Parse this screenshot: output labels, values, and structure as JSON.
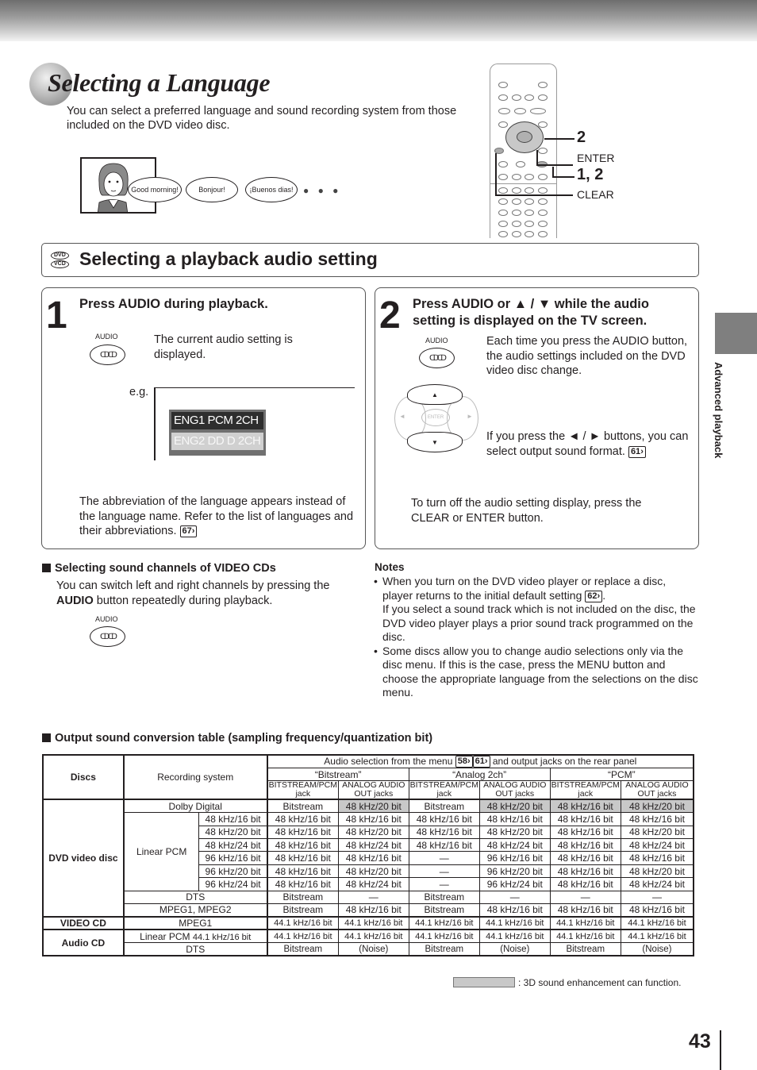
{
  "page": {
    "title": "Selecting a Language",
    "intro": "You can select a preferred language and sound recording system from those included on the DVD video disc.",
    "page_number": "43",
    "side_tab_label": "Advanced playback"
  },
  "illustration": {
    "bubbles": [
      "Good morning!",
      "Bonjour!",
      "¡Buenos dias!"
    ],
    "ellipsis": "● ● ●"
  },
  "remote": {
    "callouts": {
      "step2": "2",
      "enter": "ENTER",
      "step12": "1, 2",
      "clear": "CLEAR"
    }
  },
  "section": {
    "badges": [
      "DVD",
      "VCD"
    ],
    "title": "Selecting a playback audio setting"
  },
  "step1": {
    "number": "1",
    "heading": "Press AUDIO during playback.",
    "button_label": "AUDIO",
    "button_glyph": "ↀↀ",
    "description": "The current audio setting is displayed.",
    "eg_label": "e.g.",
    "osd_line1": "ENG1 PCM 2CH",
    "osd_line2": "ENG2 DD D 2CH",
    "footnote": "The abbreviation of the language appears instead of the language name. Refer to the list of languages and their abbreviations.",
    "footnote_ref": "67"
  },
  "step2": {
    "number": "2",
    "heading_line1": "Press AUDIO or ▲ / ▼ while the audio",
    "heading_line2": "setting is displayed on the TV screen.",
    "button_label": "AUDIO",
    "description": "Each time you press the AUDIO button, the audio settings included on the DVD video disc change.",
    "dpad": {
      "up": "▲",
      "down": "▼",
      "left": "◄",
      "right": "►",
      "center": "ENTER"
    },
    "lr_text": "If you press the ◄ / ► buttons, you can select output sound format.",
    "lr_ref": "61",
    "off_text": "To turn off the audio setting display, press the CLEAR or ENTER button."
  },
  "vcd": {
    "heading": "Selecting sound channels of VIDEO CDs",
    "text_pre": "You can switch left and right channels by pressing the ",
    "text_bold": "AUDIO",
    "text_post": " button repeatedly during playback.",
    "button_label": "AUDIO"
  },
  "notes": {
    "heading": "Notes",
    "item1_a": "When you turn on the DVD video player or replace a disc, player returns to the initial default setting ",
    "item1_ref": "62",
    "item1_b": ".",
    "item1_c": "If you select a sound track which is not included on the disc, the DVD video player plays a prior sound track programmed on the disc.",
    "item2": "Some discs allow you to change audio selections only via the disc menu.  If this is the case, press the MENU button and choose the appropriate language from the selections on the disc menu."
  },
  "table": {
    "heading": "Output sound conversion table (sampling frequency/quantization bit)",
    "col_discs": "Discs",
    "col_recording": "Recording system",
    "audio_sel_pre": "Audio selection from the menu ",
    "audio_sel_refs": [
      "58",
      "61"
    ],
    "audio_sel_post": " and output jacks on the rear panel",
    "modes": [
      "“Bitstream”",
      "“Analog 2ch”",
      "“PCM”"
    ],
    "jack_bitstream": "BITSTREAM/PCM jack",
    "jack_analog": "ANALOG AUDIO OUT jacks",
    "rows": [
      {
        "disc": "DVD video disc",
        "system": "Dolby Digital",
        "sub": "",
        "cells": [
          "Bitstream",
          "48 kHz/20 bit",
          "Bitstream",
          "48 kHz/20 bit",
          "48 kHz/16 bit",
          "48 kHz/20 bit"
        ],
        "hl": [
          false,
          true,
          false,
          true,
          true,
          true
        ]
      },
      {
        "disc": "",
        "system": "Linear PCM",
        "sub": "48 kHz/16 bit",
        "cells": [
          "48 kHz/16 bit",
          "48 kHz/16 bit",
          "48 kHz/16 bit",
          "48 kHz/16 bit",
          "48 kHz/16 bit",
          "48 kHz/16 bit"
        ]
      },
      {
        "disc": "",
        "system": "",
        "sub": "48 kHz/20 bit",
        "cells": [
          "48 kHz/16 bit",
          "48 kHz/20 bit",
          "48 kHz/16 bit",
          "48 kHz/20 bit",
          "48 kHz/16 bit",
          "48 kHz/20 bit"
        ]
      },
      {
        "disc": "",
        "system": "",
        "sub": "48 kHz/24 bit",
        "cells": [
          "48 kHz/16 bit",
          "48 kHz/24 bit",
          "48 kHz/16 bit",
          "48 kHz/24 bit",
          "48 kHz/16 bit",
          "48 kHz/24 bit"
        ]
      },
      {
        "disc": "",
        "system": "",
        "sub": "96 kHz/16 bit",
        "cells": [
          "48 kHz/16 bit",
          "48 kHz/16 bit",
          "—",
          "96 kHz/16 bit",
          "48 kHz/16 bit",
          "48 kHz/16 bit"
        ]
      },
      {
        "disc": "",
        "system": "",
        "sub": "96 kHz/20 bit",
        "cells": [
          "48 kHz/16 bit",
          "48 kHz/20 bit",
          "—",
          "96 kHz/20 bit",
          "48 kHz/16 bit",
          "48 kHz/20 bit"
        ]
      },
      {
        "disc": "",
        "system": "",
        "sub": "96 kHz/24 bit",
        "cells": [
          "48 kHz/16 bit",
          "48 kHz/24 bit",
          "—",
          "96 kHz/24 bit",
          "48 kHz/16 bit",
          "48 kHz/24 bit"
        ]
      },
      {
        "disc": "",
        "system": "DTS",
        "sub": "",
        "cells": [
          "Bitstream",
          "—",
          "Bitstream",
          "—",
          "—",
          "—"
        ]
      },
      {
        "disc": "",
        "system": "MPEG1, MPEG2",
        "sub": "",
        "cells": [
          "Bitstream",
          "48 kHz/16 bit",
          "Bitstream",
          "48 kHz/16 bit",
          "48 kHz/16 bit",
          "48 kHz/16 bit"
        ]
      },
      {
        "disc": "VIDEO CD",
        "system": "MPEG1",
        "sub": "",
        "cells": [
          "44.1 kHz/16 bit",
          "44.1 kHz/16 bit",
          "44.1 kHz/16 bit",
          "44.1 kHz/16 bit",
          "44.1 kHz/16 bit",
          "44.1 kHz/16 bit"
        ]
      },
      {
        "disc": "Audio CD",
        "system": "Linear PCM",
        "sub": "44.1 kHz/16 bit",
        "cells": [
          "44.1 kHz/16 bit",
          "44.1 kHz/16 bit",
          "44.1 kHz/16 bit",
          "44.1 kHz/16 bit",
          "44.1 kHz/16 bit",
          "44.1 kHz/16 bit"
        ]
      },
      {
        "disc": "",
        "system": "DTS",
        "sub": "",
        "cells": [
          "Bitstream",
          "(Noise)",
          "Bitstream",
          "(Noise)",
          "Bitstream",
          "(Noise)"
        ]
      }
    ],
    "legend": ": 3D sound enhancement can function.",
    "highlight_color": "#c8c8c8"
  }
}
